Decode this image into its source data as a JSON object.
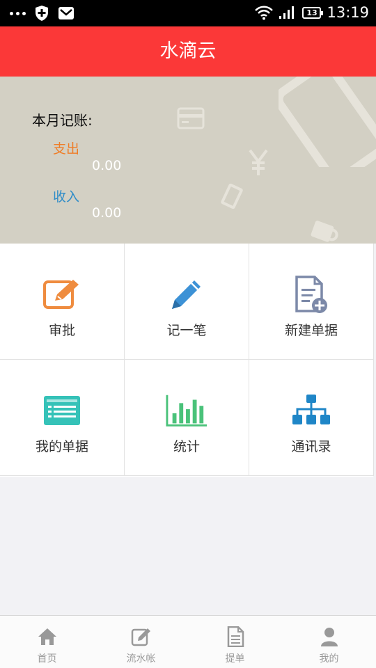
{
  "status_bar": {
    "time": "13:19",
    "battery": "13",
    "icons": [
      "more-dots-icon",
      "shield-icon",
      "mail-icon",
      "wifi-icon",
      "signal-icon",
      "battery-icon"
    ]
  },
  "header": {
    "title": "水滴云"
  },
  "summary": {
    "title": "本月记账:",
    "expense_label": "支出",
    "expense_value": "0.00",
    "income_label": "收入",
    "income_value": "0.00"
  },
  "grid": {
    "items": [
      {
        "label": "审批",
        "icon": "approval-edit-icon",
        "color": "#ef8c3f"
      },
      {
        "label": "记一笔",
        "icon": "pencil-icon",
        "color": "#3d92d6"
      },
      {
        "label": "新建单据",
        "icon": "new-document-icon",
        "color": "#7c89a8"
      },
      {
        "label": "我的单据",
        "icon": "document-list-icon",
        "color": "#35c2b8"
      },
      {
        "label": "统计",
        "icon": "bar-chart-icon",
        "color": "#4ac27a"
      },
      {
        "label": "通讯录",
        "icon": "org-chart-icon",
        "color": "#1f86c7"
      }
    ]
  },
  "tabbar": {
    "items": [
      {
        "label": "首页",
        "icon": "home-icon"
      },
      {
        "label": "流水帐",
        "icon": "edit-icon"
      },
      {
        "label": "提单",
        "icon": "document-icon"
      },
      {
        "label": "我的",
        "icon": "user-icon"
      }
    ]
  },
  "colors": {
    "header_bg": "#fb3838",
    "banner_bg": "#d3d0c4",
    "expense": "#ef7d27",
    "income": "#2e8cc8"
  }
}
